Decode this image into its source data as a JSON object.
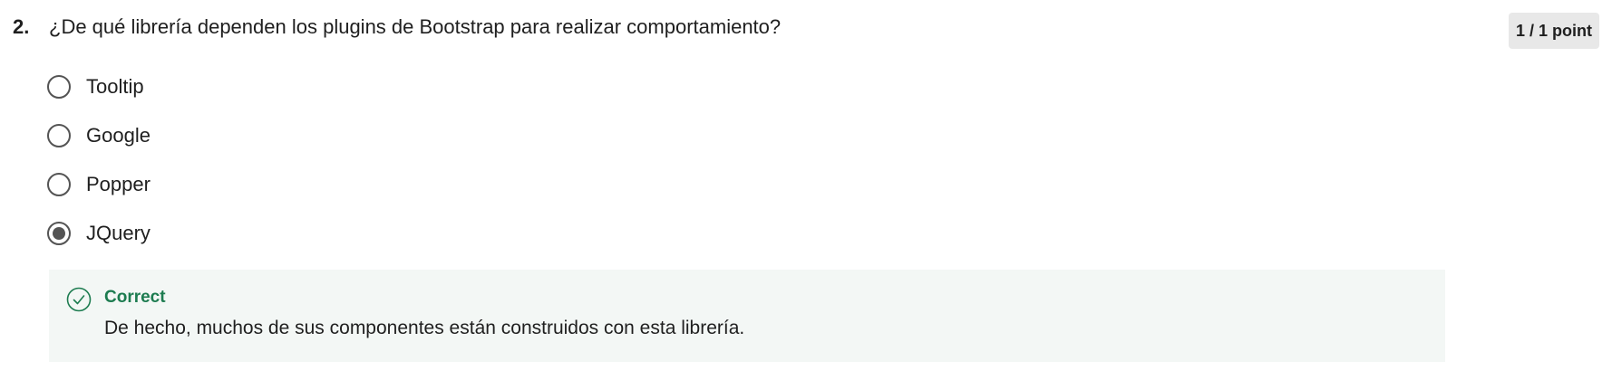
{
  "question": {
    "number": "2.",
    "text": "¿De qué librería dependen los plugins de Bootstrap para realizar comportamiento?",
    "points": "1 / 1 point",
    "options": [
      {
        "label": "Tooltip",
        "selected": false
      },
      {
        "label": "Google",
        "selected": false
      },
      {
        "label": "Popper",
        "selected": false
      },
      {
        "label": "JQuery",
        "selected": true
      }
    ],
    "feedback": {
      "status": "Correct",
      "message": "De hecho, muchos de sus componentes están construidos con esta librería.",
      "icon": "check-circle-icon"
    }
  },
  "colors": {
    "correct_green": "#1d7c50",
    "feedback_bg": "#f3f7f5",
    "badge_bg": "#e8e8e8",
    "radio_border": "#545454"
  }
}
